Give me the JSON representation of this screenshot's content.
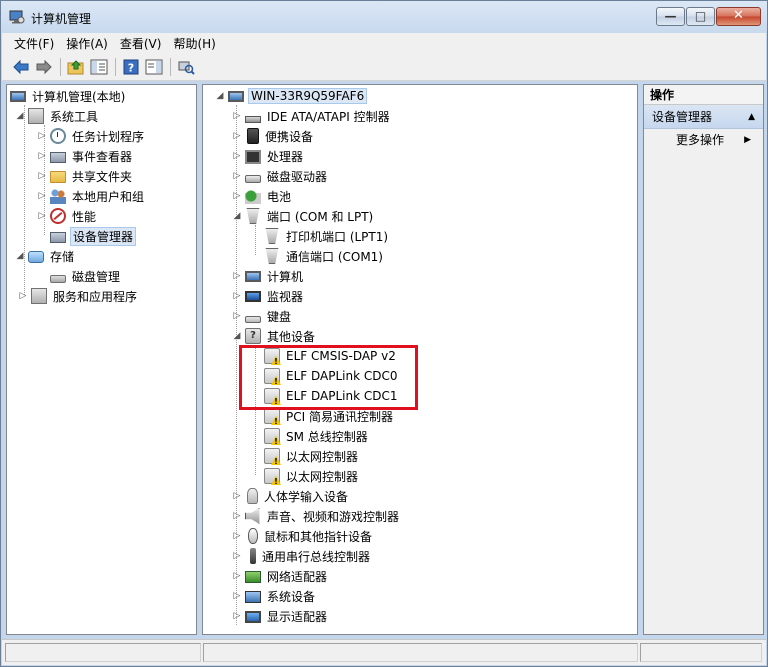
{
  "window": {
    "title": "计算机管理",
    "buttons": {
      "minimize": "—",
      "maximize": "□",
      "close": "✕"
    }
  },
  "menu": [
    "文件(F)",
    "操作(A)",
    "查看(V)",
    "帮助(H)"
  ],
  "left_tree": {
    "root": "计算机管理(本地)",
    "items": [
      {
        "label": "系统工具",
        "icon": "tools-icon"
      },
      {
        "label": "任务计划程序",
        "icon": "clock-icon"
      },
      {
        "label": "事件查看器",
        "icon": "event-viewer-icon"
      },
      {
        "label": "共享文件夹",
        "icon": "shared-folder-icon"
      },
      {
        "label": "本地用户和组",
        "icon": "users-icon"
      },
      {
        "label": "性能",
        "icon": "performance-icon"
      },
      {
        "label": "设备管理器",
        "icon": "device-manager-icon",
        "selected": true
      },
      {
        "label": "存储",
        "icon": "storage-icon"
      },
      {
        "label": "磁盘管理",
        "icon": "disk-icon"
      },
      {
        "label": "服务和应用程序",
        "icon": "services-icon"
      }
    ]
  },
  "device_tree": {
    "root": "WIN-33R9Q59FAF6",
    "items": [
      {
        "label": "IDE ATA/ATAPI 控制器",
        "icon": "ide-icon"
      },
      {
        "label": "便携设备",
        "icon": "portable-device-icon"
      },
      {
        "label": "处理器",
        "icon": "processor-icon"
      },
      {
        "label": "磁盘驱动器",
        "icon": "disk-drive-icon"
      },
      {
        "label": "电池",
        "icon": "battery-icon"
      },
      {
        "label": "端口 (COM 和 LPT)",
        "icon": "port-icon"
      },
      {
        "label": "打印机端口 (LPT1)",
        "icon": "port-icon"
      },
      {
        "label": "通信端口 (COM1)",
        "icon": "port-icon"
      },
      {
        "label": "计算机",
        "icon": "computer-icon"
      },
      {
        "label": "监视器",
        "icon": "monitor-icon"
      },
      {
        "label": "键盘",
        "icon": "keyboard-icon"
      },
      {
        "label": "其他设备",
        "icon": "unknown-device-icon"
      },
      {
        "label": "ELF CMSIS-DAP v2",
        "icon": "warning-device-icon"
      },
      {
        "label": "ELF DAPLink CDC0",
        "icon": "warning-device-icon"
      },
      {
        "label": "ELF DAPLink CDC1",
        "icon": "warning-device-icon"
      },
      {
        "label": "PCI 简易通讯控制器",
        "icon": "warning-device-icon"
      },
      {
        "label": "SM 总线控制器",
        "icon": "warning-device-icon"
      },
      {
        "label": "以太网控制器",
        "icon": "warning-device-icon"
      },
      {
        "label": "以太网控制器",
        "icon": "warning-device-icon"
      },
      {
        "label": "人体学输入设备",
        "icon": "hid-icon"
      },
      {
        "label": "声音、视频和游戏控制器",
        "icon": "audio-icon"
      },
      {
        "label": "鼠标和其他指针设备",
        "icon": "mouse-icon"
      },
      {
        "label": "通用串行总线控制器",
        "icon": "usb-icon"
      },
      {
        "label": "网络适配器",
        "icon": "network-adapter-icon"
      },
      {
        "label": "系统设备",
        "icon": "system-device-icon"
      },
      {
        "label": "显示适配器",
        "icon": "display-adapter-icon"
      }
    ]
  },
  "actions": {
    "header": "操作",
    "section": "设备管理器",
    "more": "更多操作"
  },
  "colors": {
    "highlight_box": "#e0101e",
    "selection": "#dbe7f5"
  }
}
